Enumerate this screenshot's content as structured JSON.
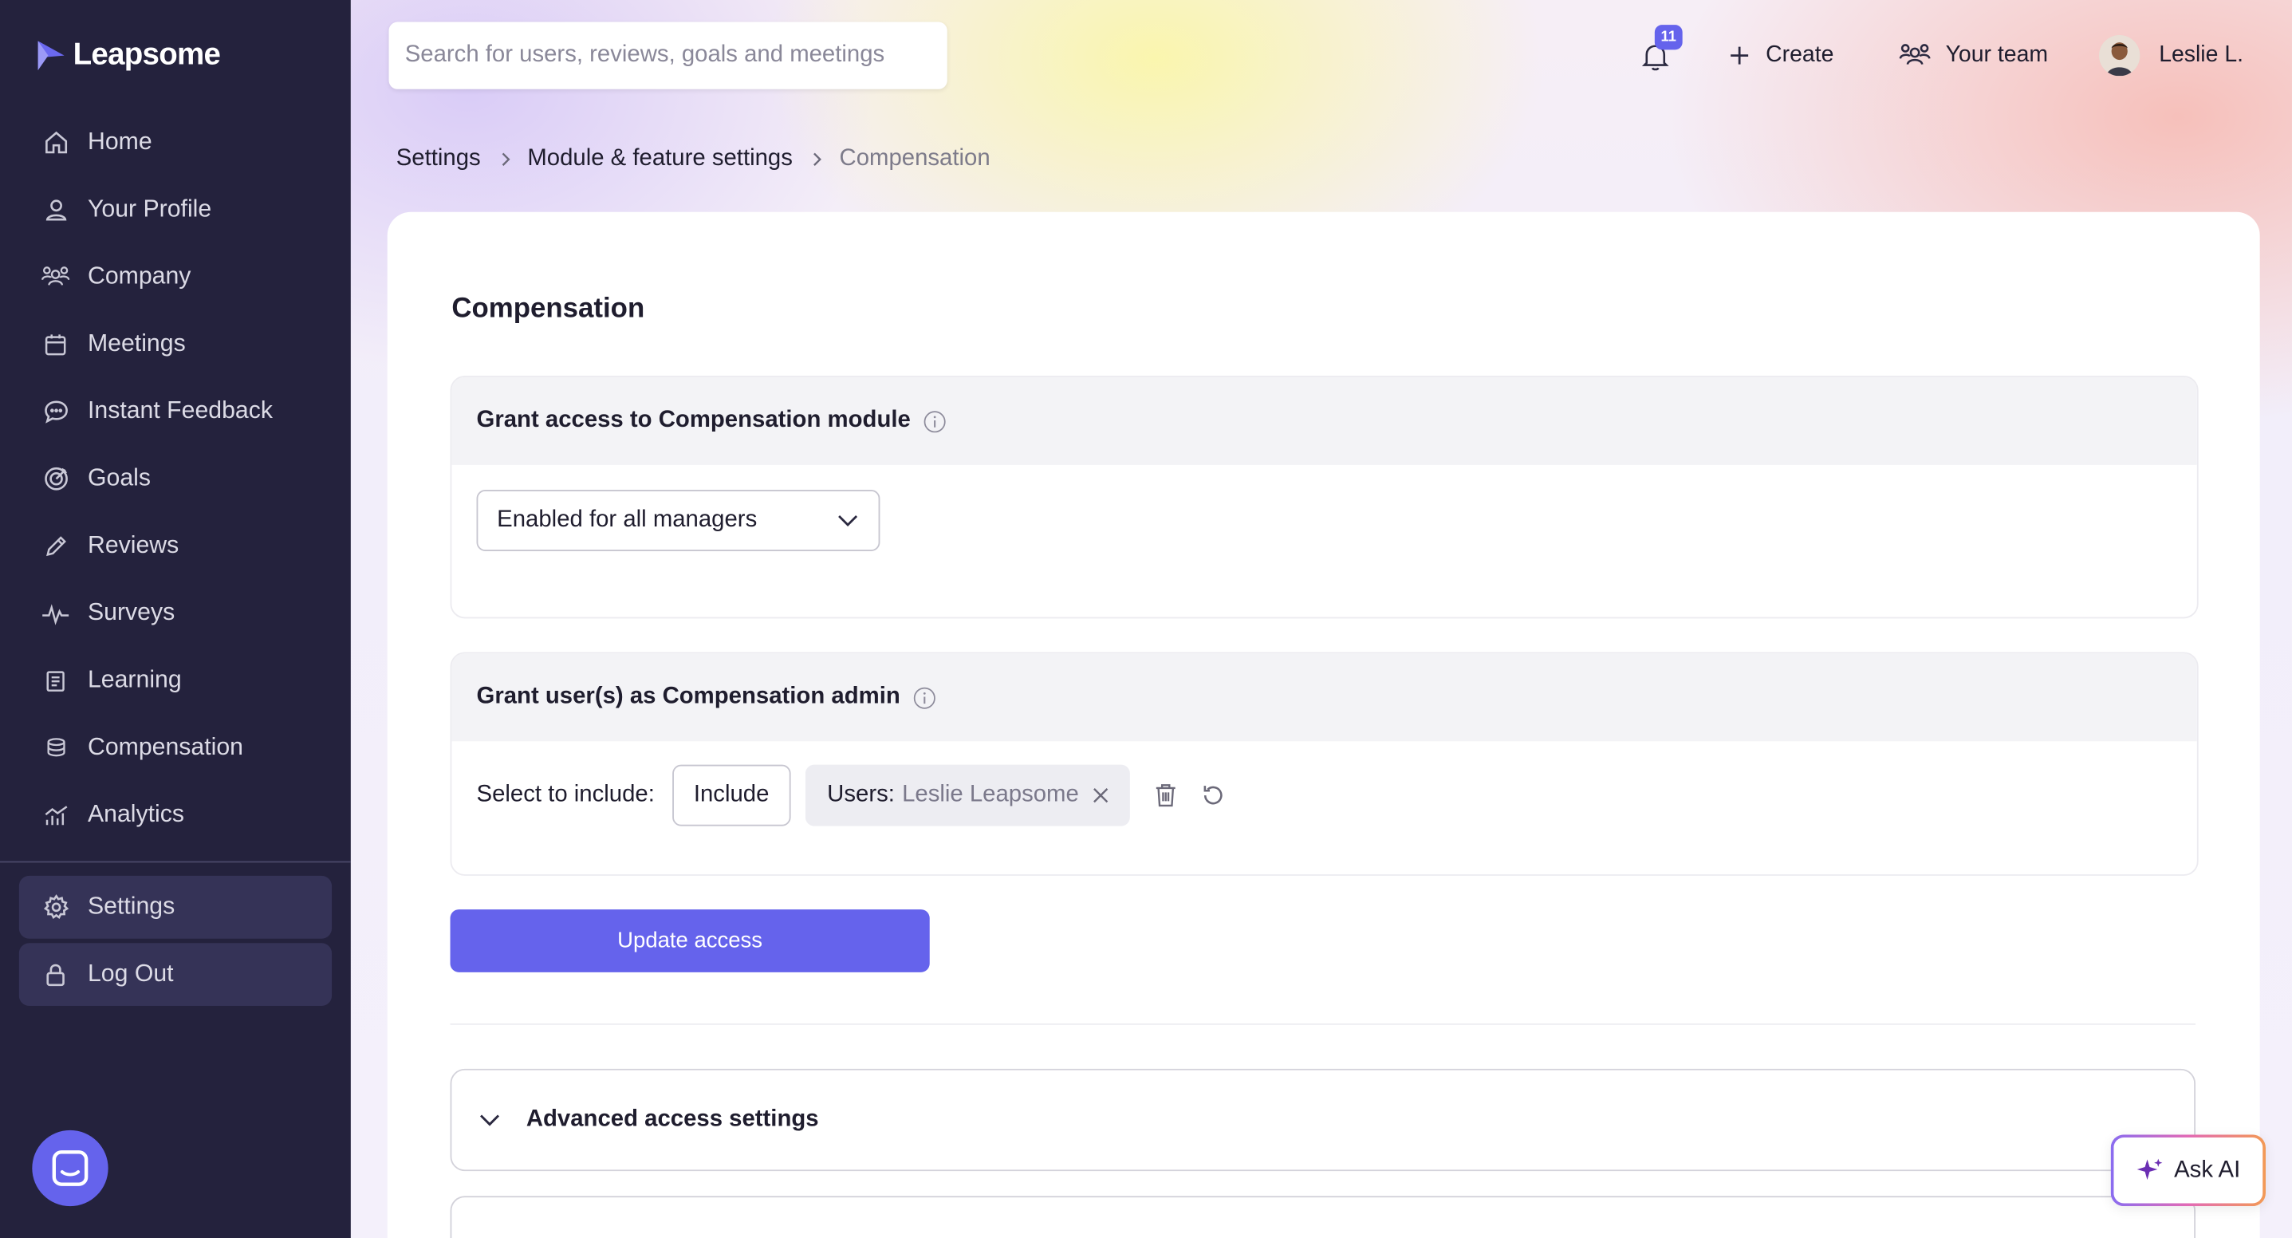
{
  "app": {
    "logo_text": "Leapsome"
  },
  "sidebar": {
    "items": [
      {
        "label": "Home",
        "icon": "home-icon"
      },
      {
        "label": "Your Profile",
        "icon": "user-icon"
      },
      {
        "label": "Company",
        "icon": "users-icon"
      },
      {
        "label": "Meetings",
        "icon": "calendar-icon"
      },
      {
        "label": "Instant Feedback",
        "icon": "chat-icon"
      },
      {
        "label": "Goals",
        "icon": "target-icon"
      },
      {
        "label": "Reviews",
        "icon": "pencil-icon"
      },
      {
        "label": "Surveys",
        "icon": "pulse-icon"
      },
      {
        "label": "Learning",
        "icon": "book-icon"
      },
      {
        "label": "Compensation",
        "icon": "coins-icon"
      },
      {
        "label": "Analytics",
        "icon": "chart-icon"
      }
    ],
    "bottom_items": [
      {
        "label": "Settings",
        "icon": "gear-icon",
        "active": true
      },
      {
        "label": "Log Out",
        "icon": "lock-icon",
        "active": true
      }
    ]
  },
  "topbar": {
    "search_placeholder": "Search for users, reviews, goals and meetings",
    "notifications_count": "11",
    "create_label": "Create",
    "team_label": "Your team",
    "user_name": "Leslie L."
  },
  "breadcrumb": [
    "Settings",
    "Module & feature settings",
    "Compensation"
  ],
  "page": {
    "title": "Compensation",
    "module_access": {
      "heading": "Grant access to Compensation module",
      "selected_option": "Enabled for all managers"
    },
    "admin_access": {
      "heading": "Grant user(s) as Compensation admin",
      "select_label": "Select to include:",
      "include_button": "Include",
      "chip_key": "Users:",
      "chip_value": "Leslie Leapsome"
    },
    "update_button": "Update access",
    "advanced_title": "Advanced access settings"
  },
  "ask_ai_label": "Ask AI",
  "colors": {
    "sidebar_bg": "#24223d",
    "accent": "#6563ec"
  }
}
